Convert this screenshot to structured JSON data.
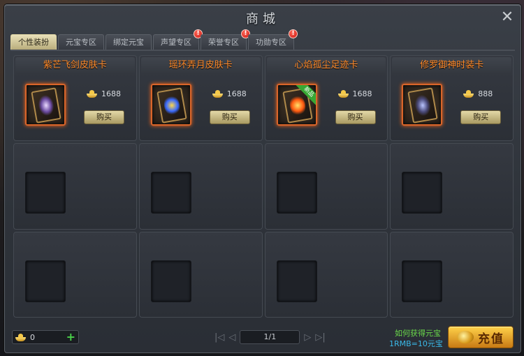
{
  "window": {
    "title": "商城"
  },
  "tabs": [
    {
      "label": "个性装扮",
      "active": true,
      "badge": ""
    },
    {
      "label": "元宝专区",
      "active": false,
      "badge": ""
    },
    {
      "label": "绑定元宝",
      "active": false,
      "badge": ""
    },
    {
      "label": "声望专区",
      "active": false,
      "badge": "!"
    },
    {
      "label": "荣誉专区",
      "active": false,
      "badge": "!"
    },
    {
      "label": "功勋专区",
      "active": false,
      "badge": "!"
    }
  ],
  "items": [
    {
      "name": "紫芒飞剑皮肤卡",
      "price": "1688",
      "buy_label": "购买",
      "art": "sword-card-icon",
      "new_tag": ""
    },
    {
      "name": "瑶环弄月皮肤卡",
      "price": "1688",
      "buy_label": "购买",
      "art": "moon-card-icon",
      "new_tag": ""
    },
    {
      "name": "心焰孤尘足迹卡",
      "price": "1688",
      "buy_label": "购买",
      "art": "flame-card-icon",
      "new_tag": "新品"
    },
    {
      "name": "修罗御神时装卡",
      "price": "888",
      "buy_label": "购买",
      "art": "robe-card-icon",
      "new_tag": ""
    }
  ],
  "footer": {
    "balance": "0",
    "page": "1/1",
    "how_to_get": "如何获得元宝",
    "rate": "1RMB=10元宝",
    "recharge_label": "充值"
  },
  "colors": {
    "item_name": "#ff8a2a",
    "accent_gold": "#f5c94a",
    "link_green": "#6ad84a",
    "rate_blue": "#3ab8e8"
  }
}
